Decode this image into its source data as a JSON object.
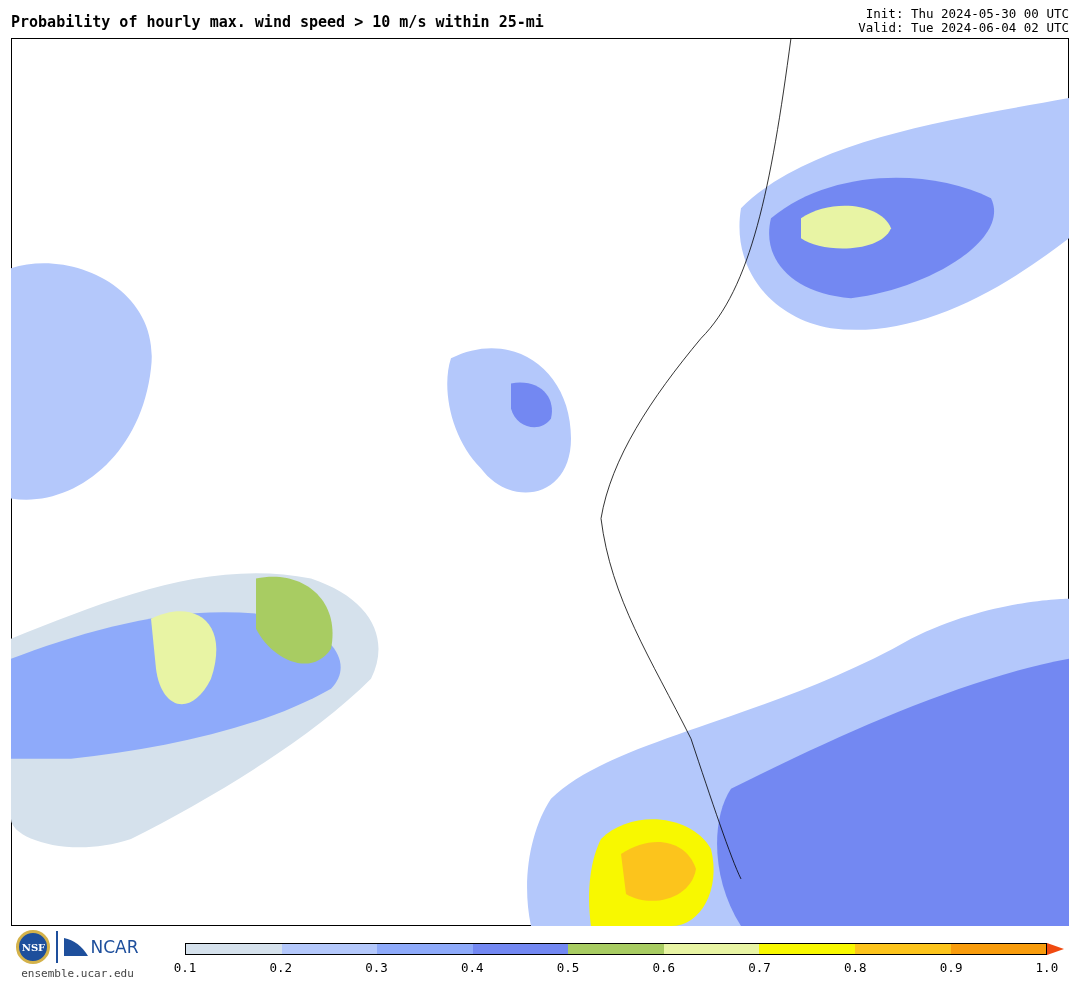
{
  "header": {
    "title": "Probability of hourly max. wind speed > 10 m/s within 25-mi",
    "init": "Init: Thu 2024-05-30 00 UTC",
    "valid": "Valid: Tue 2024-06-04 02 UTC"
  },
  "footer": {
    "logo_left": "NSF",
    "logo_right": "NCAR",
    "site": "ensemble.ucar.edu"
  },
  "colorbar": {
    "bins": [
      {
        "color": "#d5e1ec"
      },
      {
        "color": "#b4c8fb"
      },
      {
        "color": "#8eaafa"
      },
      {
        "color": "#7388f2"
      },
      {
        "color": "#a8cc62"
      },
      {
        "color": "#e8f4a4"
      },
      {
        "color": "#f8f800"
      },
      {
        "color": "#fcc41c"
      },
      {
        "color": "#f89c0c"
      }
    ],
    "arrow": {
      "color": "#f04a10"
    },
    "ticks": [
      "0.1",
      "0.2",
      "0.3",
      "0.4",
      "0.5",
      "0.6",
      "0.7",
      "0.8",
      "0.9",
      "1.0"
    ]
  }
}
